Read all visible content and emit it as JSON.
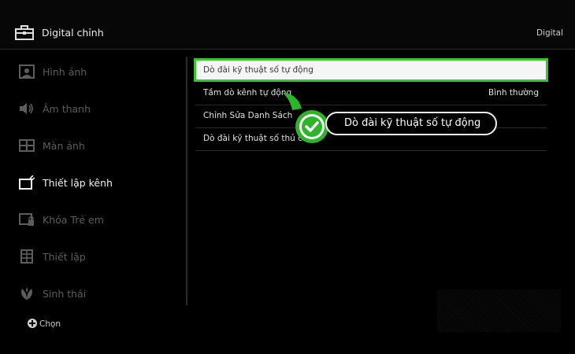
{
  "header": {
    "title": "Digital chỉnh",
    "right_label": "Digital",
    "icon": "toolbox-icon"
  },
  "sidebar": {
    "items": [
      {
        "label": "Hình ảnh",
        "icon": "picture-icon",
        "active": false
      },
      {
        "label": "Âm thanh",
        "icon": "speaker-icon",
        "active": false
      },
      {
        "label": "Màn ảnh",
        "icon": "screen-icon",
        "active": false
      },
      {
        "label": "Thiết lập kênh",
        "icon": "channel-setup-icon",
        "active": true
      },
      {
        "label": "Khóa Trẻ em",
        "icon": "child-lock-icon",
        "active": false
      },
      {
        "label": "Thiết lập",
        "icon": "setup-icon",
        "active": false
      },
      {
        "label": "Sinh thái",
        "icon": "eco-leaf-icon",
        "active": false
      }
    ]
  },
  "footer": {
    "hint": "Chọn",
    "icon": "dpad-icon"
  },
  "menu": {
    "items": [
      {
        "label": "Dò đài kỹ thuật số tự động",
        "value": "",
        "selected": true
      },
      {
        "label": "Tầm dò kênh tự động",
        "value": "Bình thường",
        "selected": false
      },
      {
        "label": "Chỉnh Sửa Danh Sách",
        "value": "",
        "selected": false
      },
      {
        "label": "Dò đài kỹ thuật số thủ cô",
        "value": "",
        "selected": false
      }
    ]
  },
  "callout": {
    "text": "Dò đài kỹ thuật số tự động",
    "icon": "checkmark-icon"
  },
  "colors": {
    "background": "#000000",
    "highlight_border": "#37c62e",
    "selected_bg": "#f5f5f5",
    "inactive_text": "#5d5d5d"
  }
}
